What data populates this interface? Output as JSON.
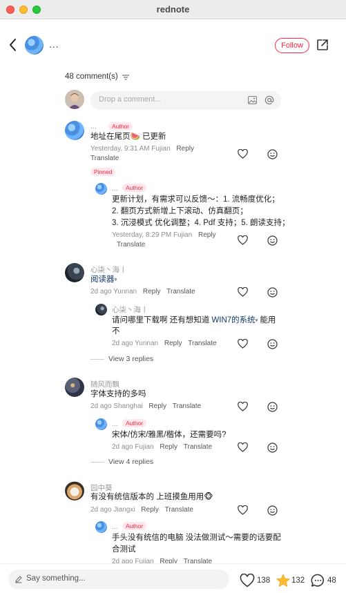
{
  "window": {
    "title": "rednote"
  },
  "header": {
    "more_label": "...",
    "follow_label": "Follow"
  },
  "comments_header": {
    "count_label": "48 comment(s)"
  },
  "comment_input": {
    "placeholder": "Drop a comment..."
  },
  "comments": [
    {
      "name": "...",
      "tag": "Author",
      "text": "地址在尾页🍉 已更新",
      "time_loc": "Yesterday, 9:31 AM Fujian",
      "reply_label": "Reply",
      "translate_label": "Translate",
      "pinned_label": "Pinned",
      "replies": [
        {
          "name": "...",
          "tag": "Author",
          "lines": [
            "更新计划，有需求可以反馈～：1. 流畅度优化；",
            "2. 翻页方式新增上下滚动、仿真翻页；",
            "3. 沉浸模式 优化调整；4. Pdf 支持；5. 朗读支持；"
          ],
          "time_loc": "Yesterday, 8:29 PM Fujian",
          "reply_label": "Reply",
          "translate_label": "Translate"
        }
      ]
    },
    {
      "name": "心柒丶海丨",
      "text": "阅读器",
      "text_suffix": "ᵠ",
      "time_loc": "2d ago Yunnan",
      "reply_label": "Reply",
      "translate_label": "Translate",
      "replies": [
        {
          "name": "心柒丶海丨",
          "line1_a": "请问哪里下载啊   还有想知道 ",
          "line1_link": "WIN7的系统",
          "line1_link_suffix": "ᵠ",
          "line1_b": " 能用",
          "line2": "不",
          "time_loc": "2d ago Yunnan",
          "reply_label": "Reply",
          "translate_label": "Translate"
        }
      ],
      "view_replies": "View 3 replies"
    },
    {
      "name": "随风而飘",
      "text": "字体支持的多吗",
      "time_loc": "2d ago Shanghai",
      "reply_label": "Reply",
      "translate_label": "Translate",
      "replies": [
        {
          "name": "...",
          "tag": "Author",
          "text": "宋体/仿宋/雅黑/楷体，还需要吗?",
          "time_loc": "2d ago Fujian",
          "reply_label": "Reply",
          "translate_label": "Translate"
        }
      ],
      "view_replies": "View 4 replies"
    },
    {
      "name": "园中葵",
      "text": "有没有统信版本的 上班摸鱼用用🐵",
      "time_loc": "2d ago Jiangxi",
      "reply_label": "Reply",
      "translate_label": "Translate",
      "replies": [
        {
          "name": "...",
          "tag": "Author",
          "lines": [
            "手头没有统信的电脑 没法做测试～需要的话要配",
            "合测试"
          ],
          "time_loc": "2d ago Fujian",
          "reply_label": "Reply",
          "translate_label": "Translate"
        }
      ]
    }
  ],
  "bottom_bar": {
    "say_placeholder": "Say something...",
    "likes": "138",
    "stars": "132",
    "comments": "48"
  }
}
